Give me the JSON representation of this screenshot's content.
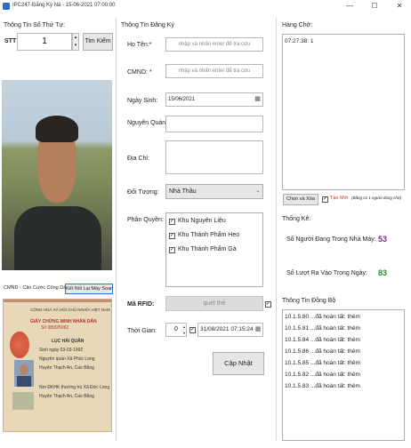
{
  "window": {
    "title": "IPC247-Đăng Ký Nä - 15-06-2021 07:00:00",
    "minimize": "—",
    "maximize": "☐",
    "close": "✕"
  },
  "queue_info": {
    "group_title": "Thông Tin Số Thứ Tự:",
    "stt_label": "STT",
    "stt_value": "1",
    "search_button": "Tim Kiếm"
  },
  "id_card": {
    "label": "CMND - Căn Cước Công Dân",
    "connect_button": "Kết Nối Lại Máy Soan",
    "card_header_1": "CỘNG HOÀ XÃ HỘI CHỦ NGHĨA VIỆT NAM",
    "card_title": "GIẤY CHỨNG MINH NHÂN DÂN",
    "card_number": "Số 0800/5062",
    "card_name": "LỤC HÀI QUÂN",
    "card_line_1": "Sinh ngày 03-03-1992",
    "card_line_2": "Nguyên quán Xã Phúc Long",
    "card_line_3": "Huyện Thạch An, Cao Bằng",
    "card_line_4": "Nơi ĐKHK thường trú Xã Đức Long",
    "card_line_5": "Huyện Thạch An, Cao Bằng"
  },
  "registration": {
    "group_title": "Thông Tin Đăng Ký",
    "name_label": "Họ Tên:*",
    "name_placeholder": "nhập và nhấn enter để tra cứu",
    "id_label": "CMND: *",
    "id_placeholder": "nhập và nhấn enter để tra cứu",
    "dob_label": "Ngày Sinh:",
    "dob_value": "15/06/2021",
    "origin_label": "Nguyên Quán:",
    "address_label": "Địa Chỉ:",
    "subject_label": "Đối Tượng:",
    "subject_value": "Nhà Thầu",
    "permission_label": "Phân Quyền:",
    "permissions": [
      "Khu Nguyên Liệu",
      "Khu Thành Phẩm Heo",
      "Khu Thành Phẩm Gà"
    ],
    "rfid_label": "Mã RFID:",
    "rfid_button": "quét thẻ",
    "time_label": "Thời Gian:",
    "time_number": "0",
    "time_value": "31/08/2021 07:15:24",
    "update_button": "Cập Nhật"
  },
  "queue": {
    "group_title": "Hàng Chờ:",
    "items": [
      "07:27:38: 1"
    ],
    "select_delete_button": "Chọn và Xóa",
    "new_checkbox_label": "Tạo Mới",
    "note": "(Bằng có 1 người đang chờ)"
  },
  "stats": {
    "group_title": "Thống Kê:",
    "in_factory_label": "Số Người Đang Trong Nhà Máy:",
    "in_factory_value": "53",
    "in_factory_color": "#7a2a8a",
    "entries_label": "Số Lượt Ra Vào Trong Ngày:",
    "entries_value": "83",
    "entries_color": "#2a8a2a"
  },
  "sync": {
    "group_title": "Thông Tin Đồng Bộ",
    "lines": [
      "10.1.5.80 ...đã hoàn tất: thêm",
      "10.1.5.81 ...đã hoàn tất: thêm",
      "10.1.5.84 ...đã hoàn tất: thêm",
      "10.1.5.86 ...đã hoàn tất: thêm",
      "10.1.5.85 ...đã hoàn tất: thêm",
      "10.1.5.82 ...đã hoàn tất: thêm",
      "10.1.5.83 ...đã hoàn tất: thêm"
    ]
  }
}
